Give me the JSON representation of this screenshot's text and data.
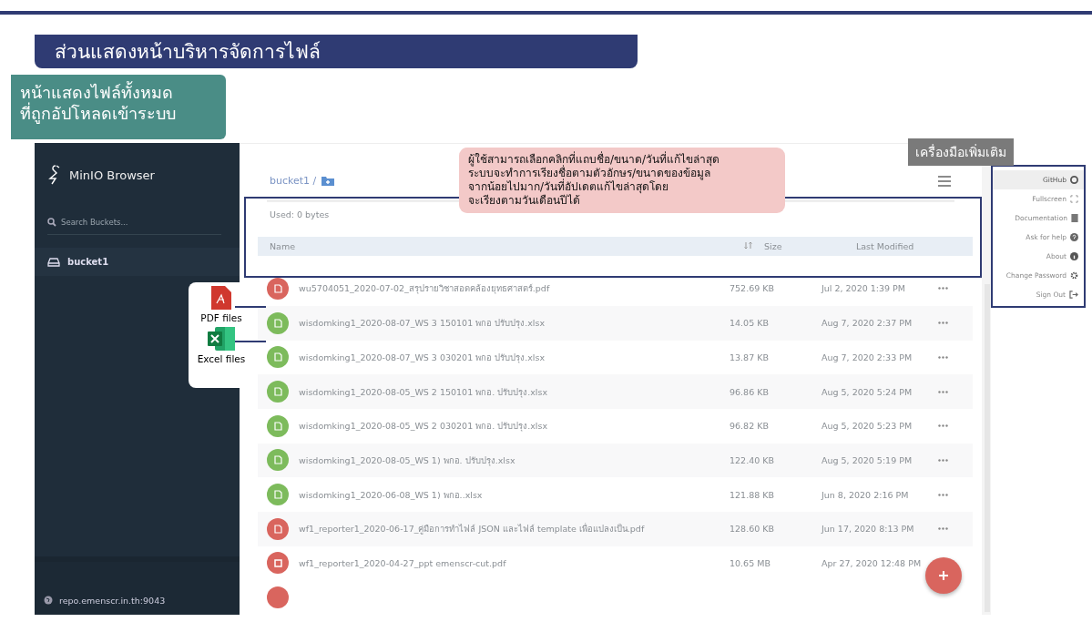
{
  "slide": {
    "title": "ส่วนแสดงหน้าบริหารจัดการไฟล์",
    "label_lines": [
      "หน้าแสดงไฟล์ทั้งหมด",
      "ที่ถูกอัปโหลดเข้าระบบ"
    ]
  },
  "annotations": {
    "sort_note": [
      "ผู้ใช้สามารถเลือกคลิกที่แถบชื่อ/ขนาด/วันที่แก้ไขล่าสุด",
      "ระบบจะทำการเรียงชื่อตามตัวอักษร/ขนาดของข้อมูล",
      "จากน้อยไปมาก/วันที่อัปเดตแก้ไขล่าสุดโดย",
      "จะเรียงตามวันเดือนปีได้"
    ],
    "tools_label": "เครื่องมือเพิ่มเติม",
    "legend": [
      {
        "kind": "pdf",
        "label": "PDF files"
      },
      {
        "kind": "excel",
        "label": "Excel files"
      }
    ]
  },
  "sidebar": {
    "app_name": "MinIO Browser",
    "search": {
      "placeholder": "Search Buckets..."
    },
    "buckets": [
      {
        "name": "bucket1",
        "selected": true
      }
    ],
    "host": "repo.emenscr.in.th:9043"
  },
  "main": {
    "breadcrumb": "bucket1 /",
    "usage": "Used: 0 bytes",
    "columns": [
      "Name",
      "Size",
      "Last Modified"
    ],
    "rows": [
      {
        "kind": "pdf",
        "name": "wu5704051_2020-07-02_สรุปรายวิชาสอดคล้องยุทธศาสตร์.pdf",
        "size": "752.69 KB",
        "modified": "Jul 2, 2020 1:39 PM"
      },
      {
        "kind": "excel",
        "name": "wisdomking1_2020-08-07_WS 3 150101 พกอ ปรับปรุง.xlsx",
        "size": "14.05 KB",
        "modified": "Aug 7, 2020 2:37 PM"
      },
      {
        "kind": "excel",
        "name": "wisdomking1_2020-08-07_WS 3 030201 พกอ ปรับปรุง.xlsx",
        "size": "13.87 KB",
        "modified": "Aug 7, 2020 2:33 PM"
      },
      {
        "kind": "excel",
        "name": "wisdomking1_2020-08-05_WS 2 150101 พกอ. ปรับปรุง.xlsx",
        "size": "96.86 KB",
        "modified": "Aug 5, 2020 5:24 PM"
      },
      {
        "kind": "excel",
        "name": "wisdomking1_2020-08-05_WS 2 030201 พกอ. ปรับปรุง.xlsx",
        "size": "96.82 KB",
        "modified": "Aug 5, 2020 5:23 PM"
      },
      {
        "kind": "excel",
        "name": "wisdomking1_2020-08-05_WS 1) พกอ. ปรับปรุง.xlsx",
        "size": "122.40 KB",
        "modified": "Aug 5, 2020 5:19 PM"
      },
      {
        "kind": "excel",
        "name": "wisdomking1_2020-06-08_WS 1) พกอ..xlsx",
        "size": "121.88 KB",
        "modified": "Jun 8, 2020 2:16 PM"
      },
      {
        "kind": "pdf",
        "name": "wf1_reporter1_2020-06-17_คู่มือการทำไฟล์ JSON และไฟล์ template เพื่อแปลงเป็น.pdf",
        "size": "128.60 KB",
        "modified": "Jun 17, 2020 8:13 PM"
      },
      {
        "kind": "other",
        "name": "wf1_reporter1_2020-04-27_ppt emenscr-cut.pdf",
        "size": "10.65 MB",
        "modified": "Apr 27, 2020 12:48 PM"
      }
    ]
  },
  "menu": {
    "items": [
      {
        "kind": "github",
        "label": "GitHub",
        "highlighted": true
      },
      {
        "kind": "fullscreen",
        "label": "Fullscreen",
        "highlighted": false
      },
      {
        "kind": "docs",
        "label": "Documentation",
        "highlighted": false
      },
      {
        "kind": "help",
        "label": "Ask for help",
        "highlighted": false
      },
      {
        "kind": "about",
        "label": "About",
        "highlighted": false
      },
      {
        "kind": "password",
        "label": "Change Password",
        "highlighted": false
      },
      {
        "kind": "signout",
        "label": "Sign Out",
        "highlighted": false
      }
    ]
  }
}
